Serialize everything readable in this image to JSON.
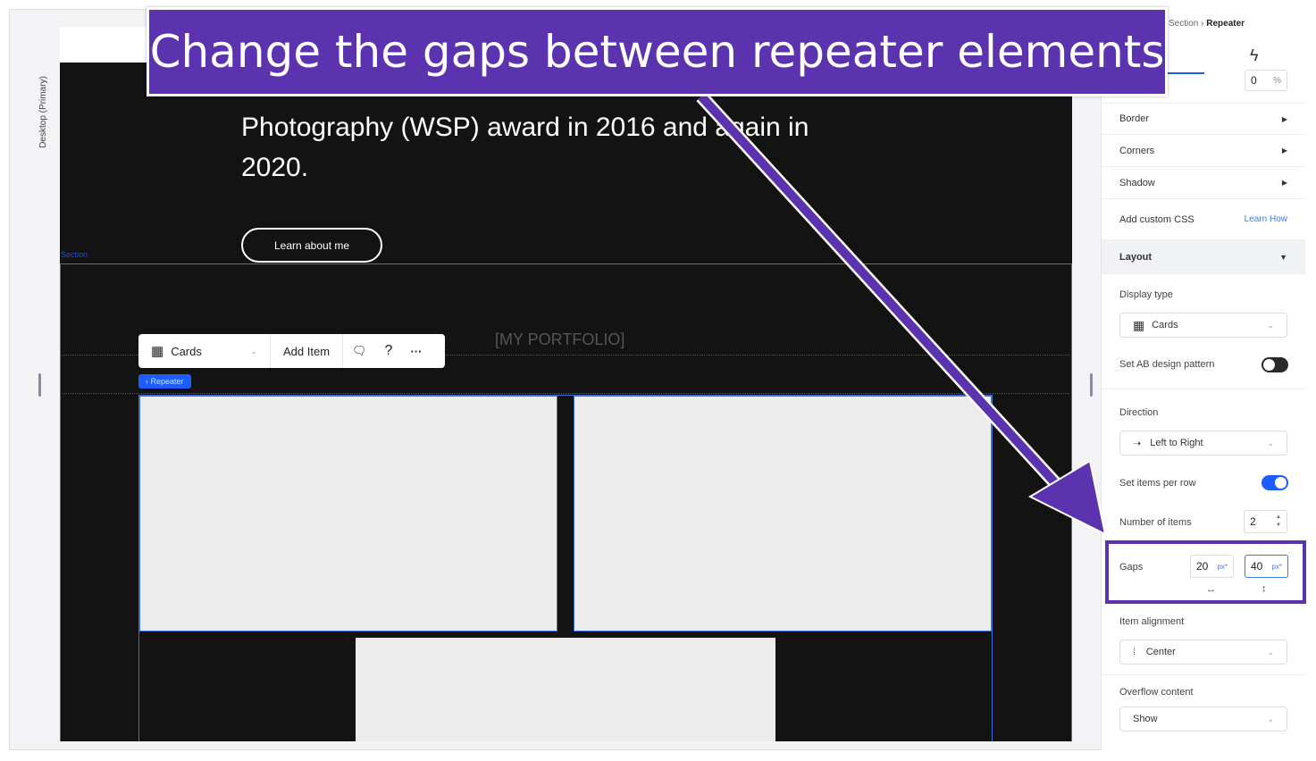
{
  "banner": {
    "text": "Change the gaps between repeater elements"
  },
  "left_rail": {
    "device_label": "Desktop (Primary)"
  },
  "canvas": {
    "hero_text": "Photography (WSP) award in 2016 and again in 2020.",
    "learn_button": "Learn about me",
    "section_label": "Section",
    "portfolio_title": "[MY PORTFOLIO]",
    "toolbar": {
      "display": "Cards",
      "add_item": "Add Item",
      "help": "?",
      "more": "···"
    },
    "repeater_tag": "‹ Repeater"
  },
  "panel": {
    "breadcrumb": {
      "parent": "Section",
      "separator": "›",
      "current": "Repeater"
    },
    "opacity_value": "0",
    "opacity_unit": "%",
    "rows": {
      "border": "Border",
      "corners": "Corners",
      "shadow": "Shadow",
      "custom_css": "Add custom CSS",
      "learn_how": "Learn How"
    },
    "layout": {
      "title": "Layout",
      "display_type_label": "Display type",
      "display_type_value": "Cards",
      "ab_pattern_label": "Set AB design pattern",
      "ab_pattern_on": false,
      "direction_label": "Direction",
      "direction_value": "Left to Right",
      "items_per_row_label": "Set items per row",
      "items_per_row_on": true,
      "number_of_items_label": "Number of items",
      "number_of_items_value": "2",
      "gaps_label": "Gaps",
      "gap_horizontal": "20",
      "gap_vertical": "40",
      "gap_unit": "px*",
      "item_alignment_label": "Item alignment",
      "item_alignment_value": "Center",
      "overflow_label": "Overflow content",
      "overflow_value": "Show"
    }
  },
  "colors": {
    "accent": "#1d5cff",
    "annotation": "#5b33ae",
    "canvas_bg": "#131313"
  }
}
